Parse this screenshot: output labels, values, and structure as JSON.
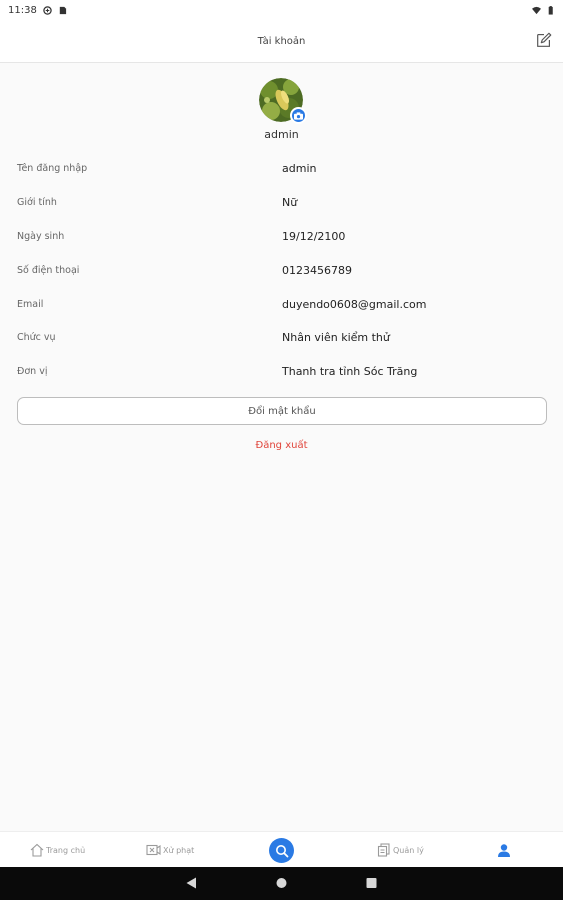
{
  "status_bar": {
    "time": "11:38",
    "icons": [
      "notification-icon",
      "sim-icon",
      "wifi-icon",
      "battery-icon"
    ]
  },
  "header": {
    "title": "Tài khoản",
    "edit_icon": "pencil-icon"
  },
  "profile": {
    "username": "admin",
    "camera_icon": "camera-icon"
  },
  "info_rows": [
    {
      "label": "Tên đăng nhập",
      "value": "admin"
    },
    {
      "label": "Giới tính",
      "value": "Nữ"
    },
    {
      "label": "Ngày sinh",
      "value": "19/12/2100"
    },
    {
      "label": "Số điện thoại",
      "value": "0123456789"
    },
    {
      "label": "Email",
      "value": "duyendo0608@gmail.com"
    },
    {
      "label": "Chức vụ",
      "value": "Nhân viên kiểm thử"
    },
    {
      "label": "Đơn vị",
      "value": "Thanh tra tỉnh Sóc Trăng"
    }
  ],
  "actions": {
    "change_password": "Đổi mật khẩu",
    "logout": "Đăng xuất"
  },
  "bottom_nav": [
    {
      "label": "Trang chủ",
      "icon": "home-icon"
    },
    {
      "label": "Xử phạt",
      "icon": "camera-sign-icon"
    },
    {
      "label": "",
      "icon": "search-icon"
    },
    {
      "label": "Quản lý",
      "icon": "documents-icon"
    },
    {
      "label": "",
      "icon": "user-icon"
    }
  ],
  "colors": {
    "accent": "#2a7ae4",
    "logout": "#e0443a"
  }
}
